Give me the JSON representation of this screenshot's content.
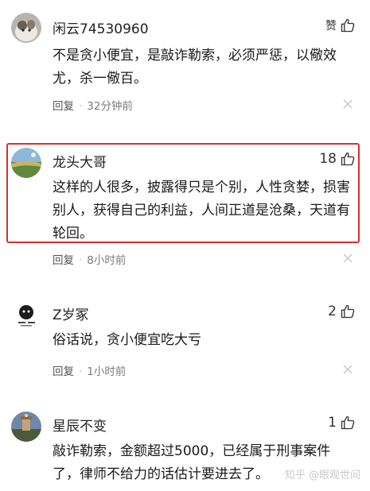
{
  "comments": [
    {
      "username": "闲云74530960",
      "likes": "赞",
      "text": "不是贪小便宜，是敲诈勒索，必须严惩，以儆效尤，杀一儆百。",
      "reply_label": "回复",
      "time": "32分钟前"
    },
    {
      "username": "龙头大哥",
      "likes": "18",
      "text": "这样的人很多，披露得只是个别，人性贪婪，损害别人，获得自己的利益，人间正道是沧桑，天道有轮回。",
      "reply_label": "回复",
      "time": "8小时前"
    },
    {
      "username": "Z岁冢",
      "likes": "2",
      "text": "俗话说，贪小便宜吃大亏",
      "reply_label": "回复",
      "time": "1小时前"
    },
    {
      "username": "星辰不变",
      "likes": "1",
      "text": "敲诈勒索，金额超过5000，已经属于刑事案件了，律师不给力的话估计要进去了。"
    }
  ],
  "watermark": "知乎 @眼观世间",
  "colors": {
    "highlight_border": "#d8302c",
    "meta_gray": "#7a7a7a"
  }
}
